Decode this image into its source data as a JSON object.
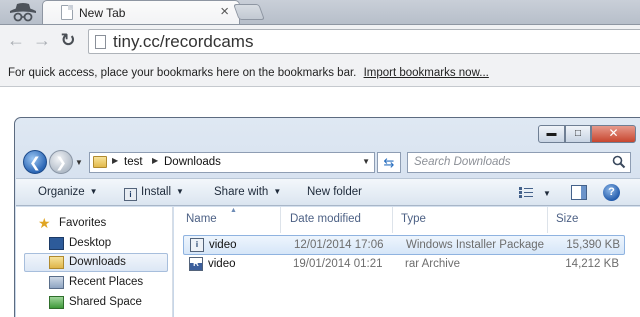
{
  "browser": {
    "tab_title": "New Tab",
    "tab_close": "×",
    "url": "tiny.cc/recordcams",
    "bookmark_bar_text": "For quick access, place your bookmarks here on the bookmarks bar.",
    "import_link": "Import bookmarks now..."
  },
  "explorer": {
    "window_buttons": {
      "minimize": "▬",
      "maximize": "□",
      "close": "✕"
    },
    "breadcrumb": [
      "test",
      "Downloads"
    ],
    "search_placeholder": "Search Downloads",
    "commands": {
      "organize": "Organize",
      "install": "Install",
      "share_with": "Share with",
      "new_folder": "New folder"
    },
    "nav": {
      "favorites": "Favorites",
      "items": [
        "Desktop",
        "Downloads",
        "Recent Places",
        "Shared Space"
      ],
      "selected": "Downloads"
    },
    "columns": {
      "name": "Name",
      "date": "Date modified",
      "type": "Type",
      "size": "Size"
    },
    "files": [
      {
        "name": "video",
        "date": "12/01/2014 17:06",
        "type": "Windows Installer Package",
        "size": "15,390 KB",
        "selected": true,
        "icon": "installer-package-icon"
      },
      {
        "name": "video",
        "date": "19/01/2014 01:21",
        "type": "rar Archive",
        "size": "14,212 KB",
        "selected": false,
        "icon": "rar-archive-icon"
      }
    ]
  }
}
